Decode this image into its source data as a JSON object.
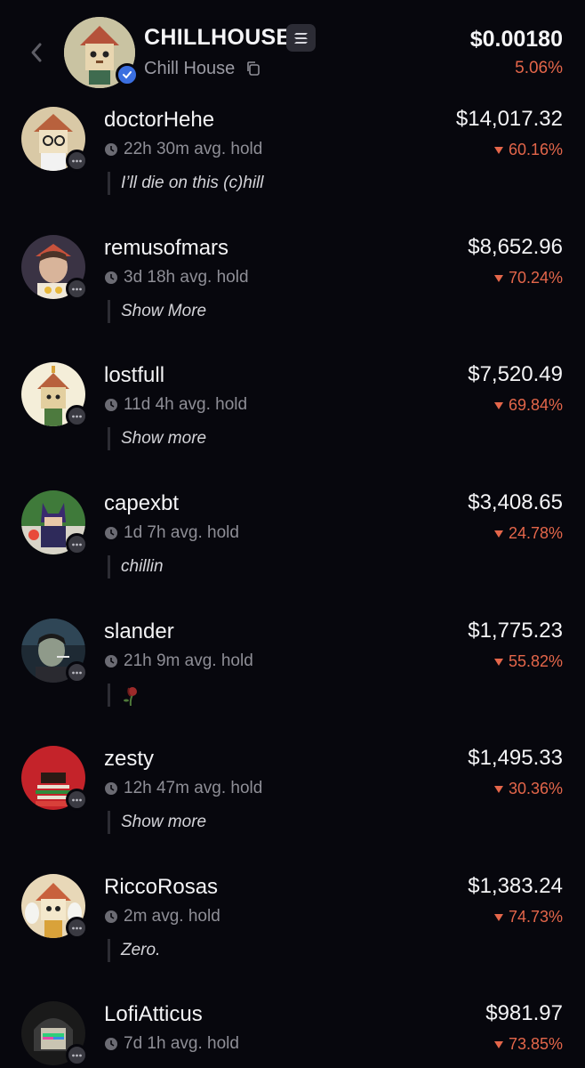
{
  "token": {
    "symbol": "CHILLHOUSE",
    "name": "Chill House",
    "price": "$0.00180",
    "change": "5.06%",
    "chain_icon": "solana-icon"
  },
  "colors": {
    "background": "#07070d",
    "negative": "#e4664a",
    "muted": "#8e8e96",
    "verified": "#3b6fe0"
  },
  "holders": [
    {
      "name": "doctorHehe",
      "hold": "22h 30m avg. hold",
      "bio": "I’ll die on this (c)hill",
      "value": "$14,017.32",
      "change": "60.16%"
    },
    {
      "name": "remusofmars",
      "hold": "3d 18h avg. hold",
      "bio": "Show More",
      "value": "$8,652.96",
      "change": "70.24%"
    },
    {
      "name": "lostfull",
      "hold": "11d 4h avg. hold",
      "bio": "Show more",
      "value": "$7,520.49",
      "change": "69.84%"
    },
    {
      "name": "capexbt",
      "hold": "1d 7h avg. hold",
      "bio": "chillin",
      "value": "$3,408.65",
      "change": "24.78%"
    },
    {
      "name": "slander",
      "hold": "21h 9m avg. hold",
      "bio": "🥀",
      "value": "$1,775.23",
      "change": "55.82%"
    },
    {
      "name": "zesty",
      "hold": "12h 47m avg. hold",
      "bio": "Show more",
      "value": "$1,495.33",
      "change": "30.36%"
    },
    {
      "name": "RiccoRosas",
      "hold": "2m avg. hold",
      "bio": "Zero.",
      "value": "$1,383.24",
      "change": "74.73%"
    },
    {
      "name": "LofiAtticus",
      "hold": "7d 1h avg. hold",
      "bio": "",
      "value": "$981.97",
      "change": "73.85%"
    }
  ]
}
